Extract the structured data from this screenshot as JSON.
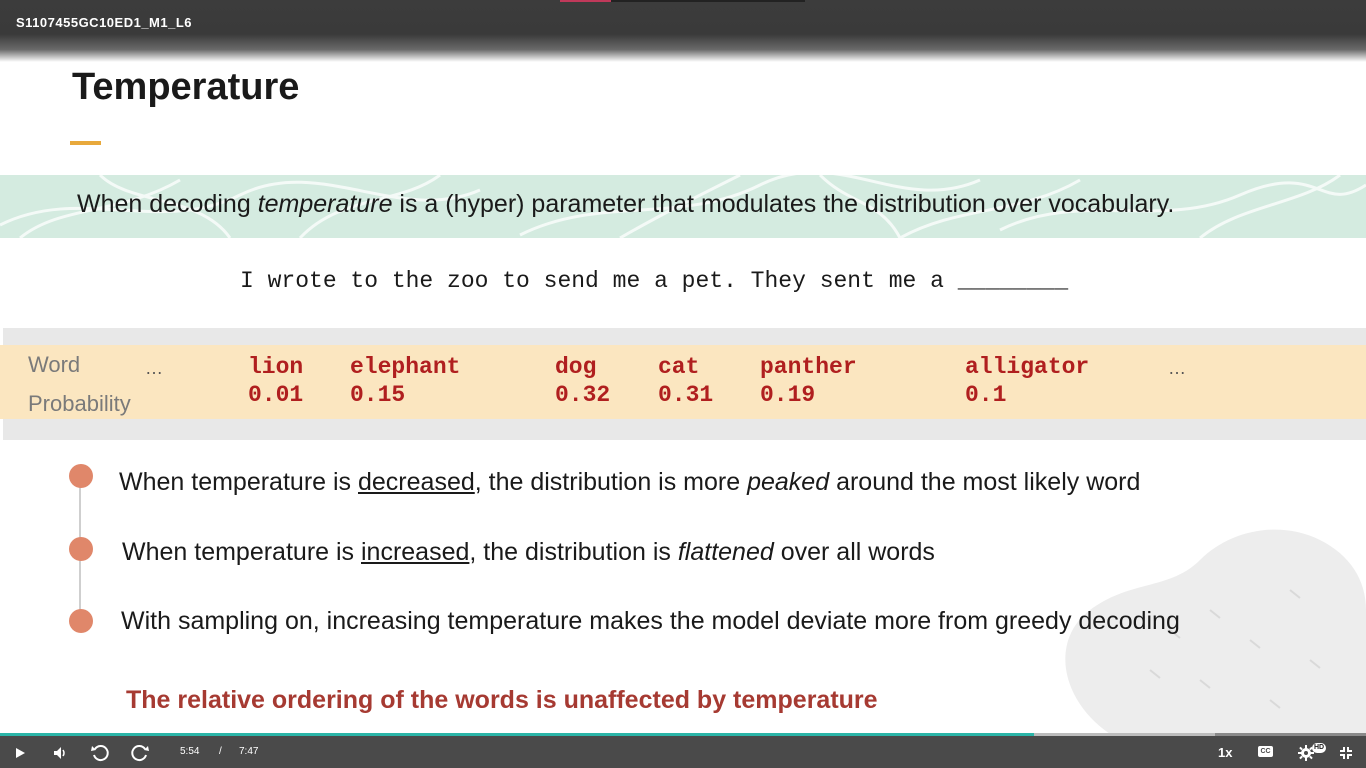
{
  "video": {
    "title": "S1107455GC10ED1_M1_L6",
    "progress": 0.21
  },
  "slide": {
    "title": "Temperature",
    "definition": {
      "before": "When decoding ",
      "emphasis": "temperature",
      "after": " is a (hyper) parameter that modulates the distribution over vocabulary."
    },
    "sentence": "I wrote to the zoo to send me a pet. They sent me a ________",
    "table": {
      "word_label": "Word",
      "prob_label": "Probability",
      "ellipsis_left": "…",
      "ellipsis_right": "…",
      "words": [
        {
          "word": "lion",
          "prob": "0.01"
        },
        {
          "word": "elephant",
          "prob": "0.15"
        },
        {
          "word": "dog",
          "prob": "0.32"
        },
        {
          "word": "cat",
          "prob": "0.31"
        },
        {
          "word": "panther",
          "prob": "0.19"
        },
        {
          "word": "alligator",
          "prob": "0.1"
        }
      ]
    },
    "bullets": [
      {
        "a": "When temperature is ",
        "u": "decreased",
        "b": ", the distribution is more ",
        "em": "peaked",
        "c": " around the most likely word"
      },
      {
        "a": "When temperature is ",
        "u": "increased",
        "b": ", the distribution is ",
        "em": "flattened",
        "c": " over all words"
      },
      {
        "a": "With sampling on, increasing temperature makes the model deviate more from greedy decoding"
      }
    ],
    "takeaway": "The relative ordering of the words is unaffected by temperature"
  },
  "player": {
    "current_time": "5:54",
    "separator": "/",
    "duration": "7:47",
    "played_fraction": 0.757,
    "speed": "1x",
    "cc_label": "CC",
    "hd_label": "HD",
    "icons": [
      "play-icon",
      "volume-icon",
      "rewind-icon",
      "forward-icon",
      "captions-icon",
      "settings-icon",
      "exit-fullscreen-icon"
    ]
  },
  "colors": {
    "accent_orange": "#e8a93c",
    "word_red": "#b01f1f",
    "takeaway_red": "#a63a32",
    "bullet_dot": "#e0876a",
    "band_green": "#d4ebe0",
    "table_yellow": "#fbe6c0",
    "seek_teal": "#2bb5a8"
  }
}
